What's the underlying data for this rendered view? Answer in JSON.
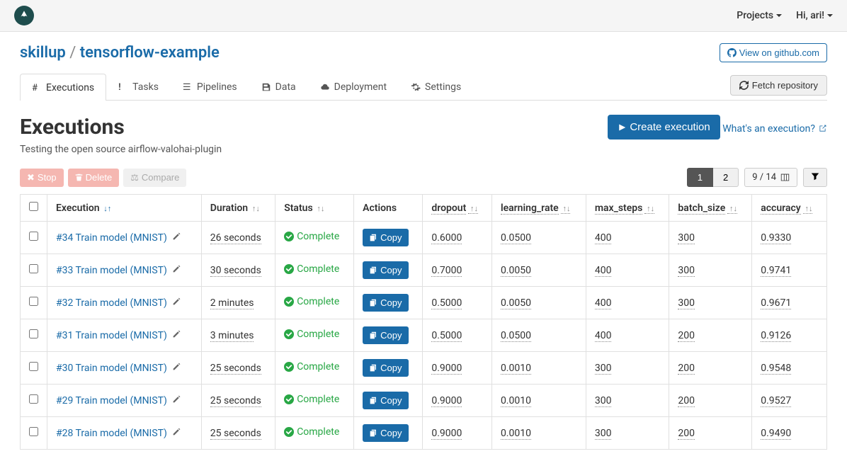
{
  "topbar": {
    "projects_label": "Projects",
    "user_greeting": "Hi, ari!"
  },
  "breadcrumb": {
    "org": "skillup",
    "project": "tensorflow-example"
  },
  "github_button": "View on github.com",
  "tabs": [
    {
      "label": "Executions",
      "icon": "hash"
    },
    {
      "label": "Tasks",
      "icon": "exclaim"
    },
    {
      "label": "Pipelines",
      "icon": "bars"
    },
    {
      "label": "Data",
      "icon": "save"
    },
    {
      "label": "Deployment",
      "icon": "cloud"
    },
    {
      "label": "Settings",
      "icon": "gear"
    }
  ],
  "fetch_button": "Fetch repository",
  "page": {
    "title": "Executions",
    "subtitle": "Testing the open source airflow-valohai-plugin"
  },
  "create_button": "Create execution",
  "whats_link": "What's an execution?",
  "toolbar": {
    "stop": "Stop",
    "delete": "Delete",
    "compare": "Compare"
  },
  "pager": {
    "page1": "1",
    "page2": "2"
  },
  "columns_info": "9 / 14",
  "table": {
    "headers": {
      "execution": "Execution",
      "duration": "Duration",
      "status": "Status",
      "actions": "Actions",
      "dropout": "dropout",
      "learning_rate": "learning_rate",
      "max_steps": "max_steps",
      "batch_size": "batch_size",
      "accuracy": "accuracy"
    },
    "copy_label": "Copy",
    "status_label": "Complete",
    "rows": [
      {
        "name": "#34 Train model (MNIST)",
        "duration": "26 seconds",
        "dropout": "0.6000",
        "learning_rate": "0.0500",
        "max_steps": "400",
        "batch_size": "300",
        "accuracy": "0.9330"
      },
      {
        "name": "#33 Train model (MNIST)",
        "duration": "30 seconds",
        "dropout": "0.7000",
        "learning_rate": "0.0050",
        "max_steps": "400",
        "batch_size": "300",
        "accuracy": "0.9741"
      },
      {
        "name": "#32 Train model (MNIST)",
        "duration": "2 minutes",
        "dropout": "0.5000",
        "learning_rate": "0.0050",
        "max_steps": "400",
        "batch_size": "300",
        "accuracy": "0.9671"
      },
      {
        "name": "#31 Train model (MNIST)",
        "duration": "3 minutes",
        "dropout": "0.5000",
        "learning_rate": "0.0500",
        "max_steps": "400",
        "batch_size": "200",
        "accuracy": "0.9126"
      },
      {
        "name": "#30 Train model (MNIST)",
        "duration": "25 seconds",
        "dropout": "0.9000",
        "learning_rate": "0.0010",
        "max_steps": "300",
        "batch_size": "200",
        "accuracy": "0.9548"
      },
      {
        "name": "#29 Train model (MNIST)",
        "duration": "25 seconds",
        "dropout": "0.9000",
        "learning_rate": "0.0010",
        "max_steps": "300",
        "batch_size": "200",
        "accuracy": "0.9527"
      },
      {
        "name": "#28 Train model (MNIST)",
        "duration": "25 seconds",
        "dropout": "0.9000",
        "learning_rate": "0.0010",
        "max_steps": "300",
        "batch_size": "200",
        "accuracy": "0.9490"
      }
    ]
  }
}
